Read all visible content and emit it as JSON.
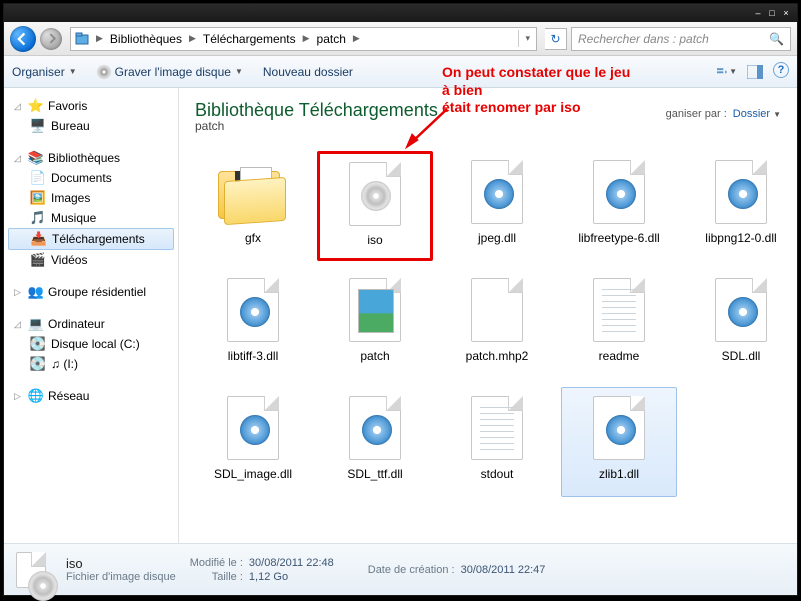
{
  "window_controls": {
    "min": "–",
    "max": "□",
    "close": "×"
  },
  "breadcrumb": {
    "seg1": "Bibliothèques",
    "seg2": "Téléchargements",
    "seg3": "patch"
  },
  "search": {
    "placeholder": "Rechercher dans : patch"
  },
  "toolbar": {
    "organize": "Organiser",
    "burn": "Graver l'image disque",
    "newfolder": "Nouveau dossier"
  },
  "annotation": {
    "line1": "On peut constater que le jeu",
    "line2": "à bien",
    "line3": "était renomer par iso"
  },
  "sidebar": {
    "favorites": {
      "label": "Favoris",
      "items": [
        {
          "icon": "desktop",
          "label": "Bureau"
        }
      ]
    },
    "libraries": {
      "label": "Bibliothèques",
      "items": [
        {
          "icon": "doc",
          "label": "Documents"
        },
        {
          "icon": "img",
          "label": "Images"
        },
        {
          "icon": "music",
          "label": "Musique"
        },
        {
          "icon": "dl",
          "label": "Téléchargements",
          "selected": true
        },
        {
          "icon": "video",
          "label": "Vidéos"
        }
      ]
    },
    "homegroup": {
      "label": "Groupe résidentiel"
    },
    "computer": {
      "label": "Ordinateur",
      "items": [
        {
          "icon": "disk",
          "label": "Disque local (C:)"
        },
        {
          "icon": "music",
          "label": "♫ (I:)"
        }
      ]
    },
    "network": {
      "label": "Réseau"
    }
  },
  "library_header": {
    "title": "Bibliothèque Téléchargements",
    "subtitle": "patch",
    "arrange_label": "ganiser par :",
    "arrange_value": "Dossier"
  },
  "files": [
    {
      "name": "gfx",
      "kind": "folder"
    },
    {
      "name": "iso",
      "kind": "disc",
      "highlighted": true
    },
    {
      "name": "jpeg.dll",
      "kind": "gear"
    },
    {
      "name": "libfreetype-6.dll",
      "kind": "gear"
    },
    {
      "name": "libpng12-0.dll",
      "kind": "gear"
    },
    {
      "name": "libtiff-3.dll",
      "kind": "gear"
    },
    {
      "name": "patch",
      "kind": "image"
    },
    {
      "name": "patch.mhp2",
      "kind": "blank"
    },
    {
      "name": "readme",
      "kind": "text"
    },
    {
      "name": "SDL.dll",
      "kind": "gear"
    },
    {
      "name": "SDL_image.dll",
      "kind": "gear"
    },
    {
      "name": "SDL_ttf.dll",
      "kind": "gear"
    },
    {
      "name": "stdout",
      "kind": "text"
    },
    {
      "name": "zlib1.dll",
      "kind": "gear",
      "selected": true
    }
  ],
  "details": {
    "name": "iso",
    "type": "Fichier d'image disque",
    "mod_label": "Modifié le :",
    "mod_value": "30/08/2011 22:48",
    "size_label": "Taille :",
    "size_value": "1,12 Go",
    "created_label": "Date de création :",
    "created_value": "30/08/2011 22:47"
  }
}
